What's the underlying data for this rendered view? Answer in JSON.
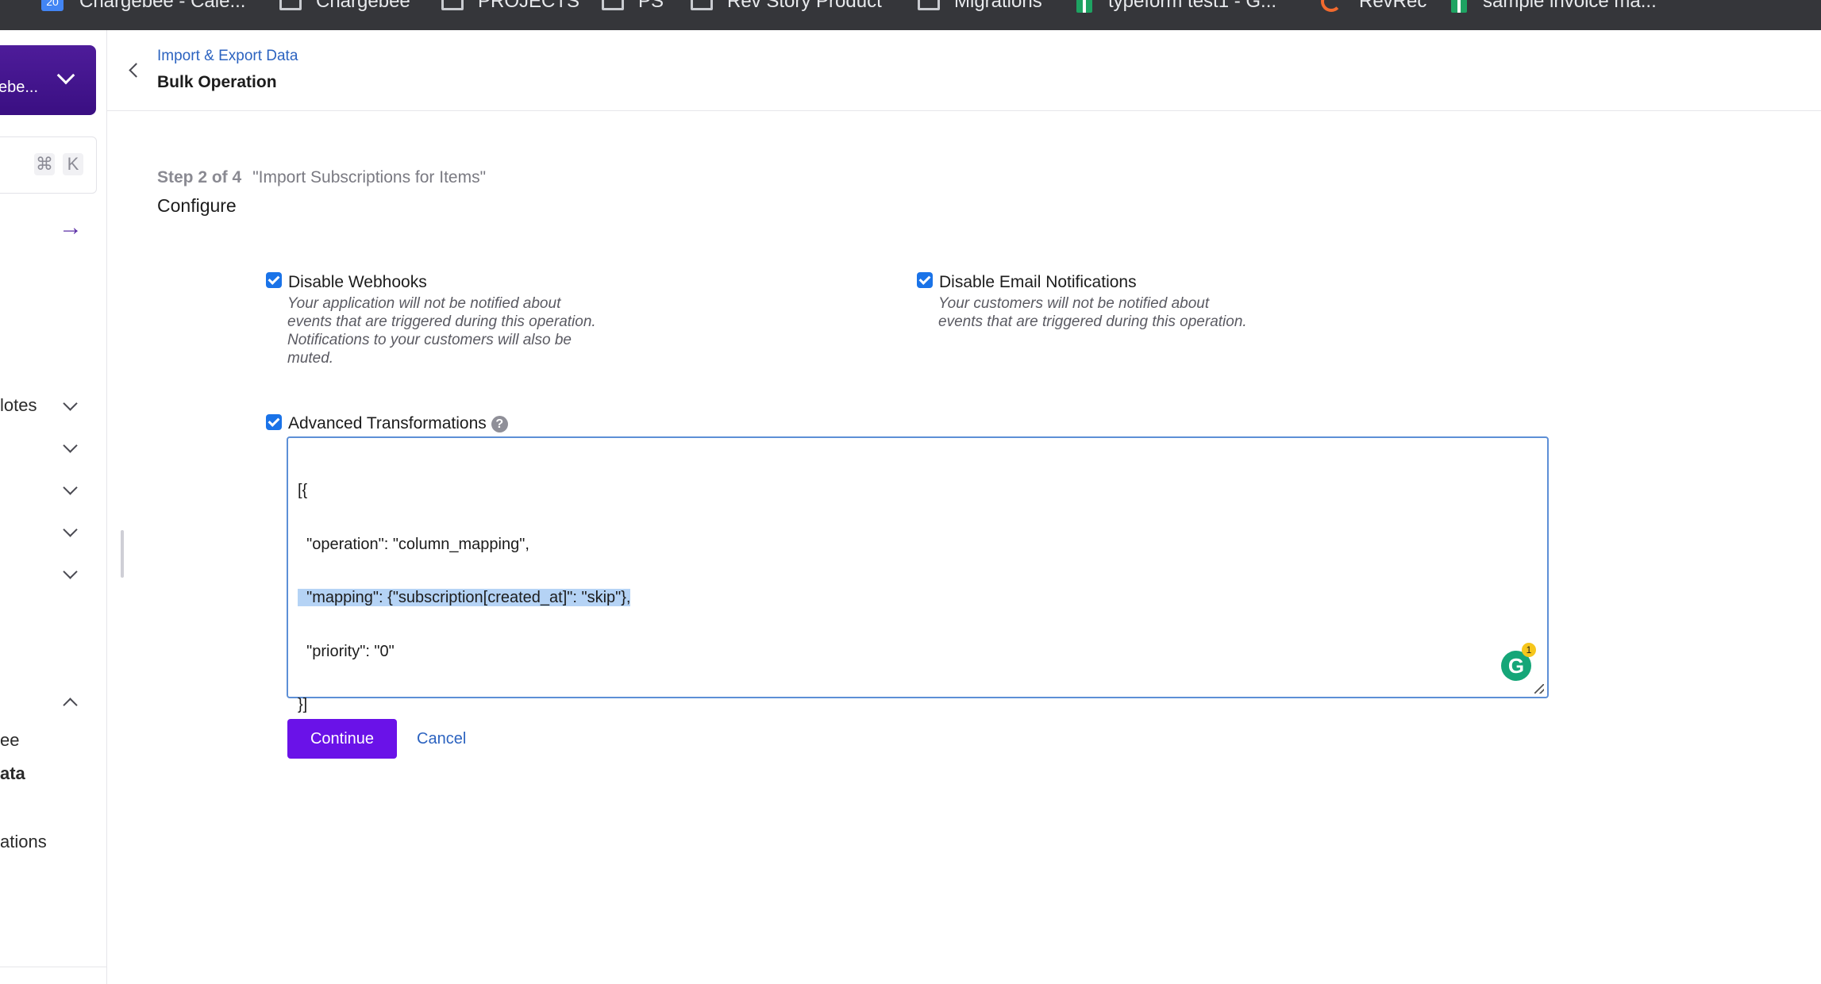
{
  "bookmarks": [
    {
      "label": "Chargebee - Cale...",
      "icon": "calendar-icon"
    },
    {
      "label": "Chargebee",
      "icon": "folder-icon"
    },
    {
      "label": "PROJECTS",
      "icon": "folder-icon"
    },
    {
      "label": "PS",
      "icon": "folder-icon"
    },
    {
      "label": "Rev Story Product",
      "icon": "folder-icon"
    },
    {
      "label": "Migrations",
      "icon": "folder-icon"
    },
    {
      "label": "typeform test1 - G...",
      "icon": "sheets-icon"
    },
    {
      "label": "RevRec",
      "icon": "revrec-icon"
    },
    {
      "label": "sample invoice ma...",
      "icon": "sheets-icon"
    }
  ],
  "sidebar": {
    "site_label": "ebe...",
    "shortcut_keys": [
      "⌘",
      "K"
    ],
    "items": [
      {
        "label": "lotes"
      },
      {
        "label": ""
      },
      {
        "label": ""
      },
      {
        "label": ""
      },
      {
        "label": ""
      },
      {
        "label": ""
      },
      {
        "label": "ee"
      },
      {
        "label": "ata"
      },
      {
        "label": "ations"
      }
    ]
  },
  "header": {
    "breadcrumb": "Import & Export Data",
    "title": "Bulk Operation"
  },
  "step": {
    "progress": "Step 2 of 4",
    "operation_name": "\"Import Subscriptions for Items\"",
    "subtitle": "Configure"
  },
  "options": {
    "webhooks": {
      "label": "Disable Webhooks",
      "checked": true,
      "description_lines": [
        "Your application will not be notified about",
        "events that are triggered during this operation.",
        "Notifications to your customers will also be",
        "muted."
      ]
    },
    "email": {
      "label": "Disable Email Notifications",
      "checked": true,
      "description_lines": [
        "Your customers will not be notified about",
        "events that are triggered during this operation."
      ]
    },
    "advanced": {
      "label": "Advanced Transformations",
      "checked": true,
      "help_glyph": "?"
    }
  },
  "editor": {
    "lines": [
      "[{",
      "  \"operation\": \"column_mapping\",",
      "  \"mapping\": {\"subscription[created_at]\": \"skip\"},",
      "  \"priority\": \"0\"",
      "}]"
    ],
    "grammarly_count": "1"
  },
  "actions": {
    "continue_label": "Continue",
    "cancel_label": "Cancel"
  },
  "colors": {
    "primary": "#6a12e8",
    "link": "#2c63c0",
    "checkbox": "#1a73e8",
    "site_switcher": "#3a0f82"
  }
}
